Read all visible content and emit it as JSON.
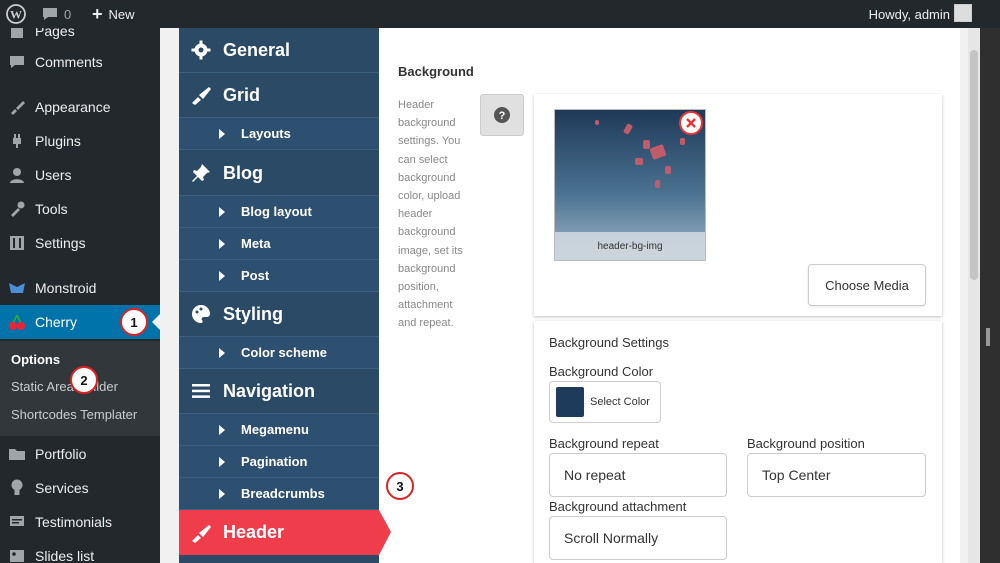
{
  "adminbar": {
    "comments_count": "0",
    "new_label": "New",
    "howdy": "Howdy, admin"
  },
  "wpmenu": {
    "items": [
      {
        "label": "Pages",
        "icon": "pages-icon"
      },
      {
        "label": "Comments",
        "icon": "comment-bubble-icon"
      },
      {
        "label": "Appearance",
        "icon": "paintbrush-icon"
      },
      {
        "label": "Plugins",
        "icon": "plug-icon"
      },
      {
        "label": "Users",
        "icon": "user-icon"
      },
      {
        "label": "Tools",
        "icon": "wrench-icon"
      },
      {
        "label": "Settings",
        "icon": "sliders-icon"
      },
      {
        "label": "Monstroid",
        "icon": "monster-icon"
      },
      {
        "label": "Cherry",
        "icon": "cherry-icon"
      },
      {
        "label": "Portfolio",
        "icon": "folder-icon"
      },
      {
        "label": "Services",
        "icon": "lightbulb-icon"
      },
      {
        "label": "Testimonials",
        "icon": "testimonial-icon"
      },
      {
        "label": "Slides list",
        "icon": "slides-icon"
      }
    ],
    "submenu": [
      {
        "label": "Options"
      },
      {
        "label": "Static Area Builder"
      },
      {
        "label": "Shortcodes Templater"
      }
    ]
  },
  "optnav": {
    "sections": [
      {
        "label": "General",
        "icon": "gear-icon"
      },
      {
        "label": "Grid",
        "icon": "brush-icon"
      },
      {
        "label": "Blog",
        "icon": "pin-icon"
      },
      {
        "label": "Styling",
        "icon": "palette-icon"
      },
      {
        "label": "Navigation",
        "icon": "bars-icon"
      },
      {
        "label": "Header",
        "icon": "brush-icon"
      }
    ],
    "subs": {
      "grid": [
        "Layouts"
      ],
      "blog": [
        "Blog layout",
        "Meta",
        "Post"
      ],
      "styling": [
        "Color scheme"
      ],
      "navigation": [
        "Megamenu",
        "Pagination",
        "Breadcrumbs"
      ]
    }
  },
  "panel": {
    "title": "Background",
    "description": "Header background settings. You can select background color, upload header background image, set its background position, attachment and repeat.",
    "media": {
      "caption": "header-bg-img",
      "choose_label": "Choose Media"
    },
    "settings": {
      "heading": "Background Settings",
      "color_label": "Background Color",
      "color_button": "Select Color",
      "color_value": "#1f3b5c",
      "repeat_label": "Background repeat",
      "repeat_value": "No repeat",
      "position_label": "Background position",
      "position_value": "Top Center",
      "attachment_label": "Background attachment",
      "attachment_value": "Scroll Normally"
    }
  },
  "steps": [
    "1",
    "2",
    "3"
  ],
  "colors": {
    "wp_dark": "#23282d",
    "wp_blue": "#0073aa",
    "nav_blue": "#2a4a66",
    "accent_red": "#ef3d4c"
  }
}
